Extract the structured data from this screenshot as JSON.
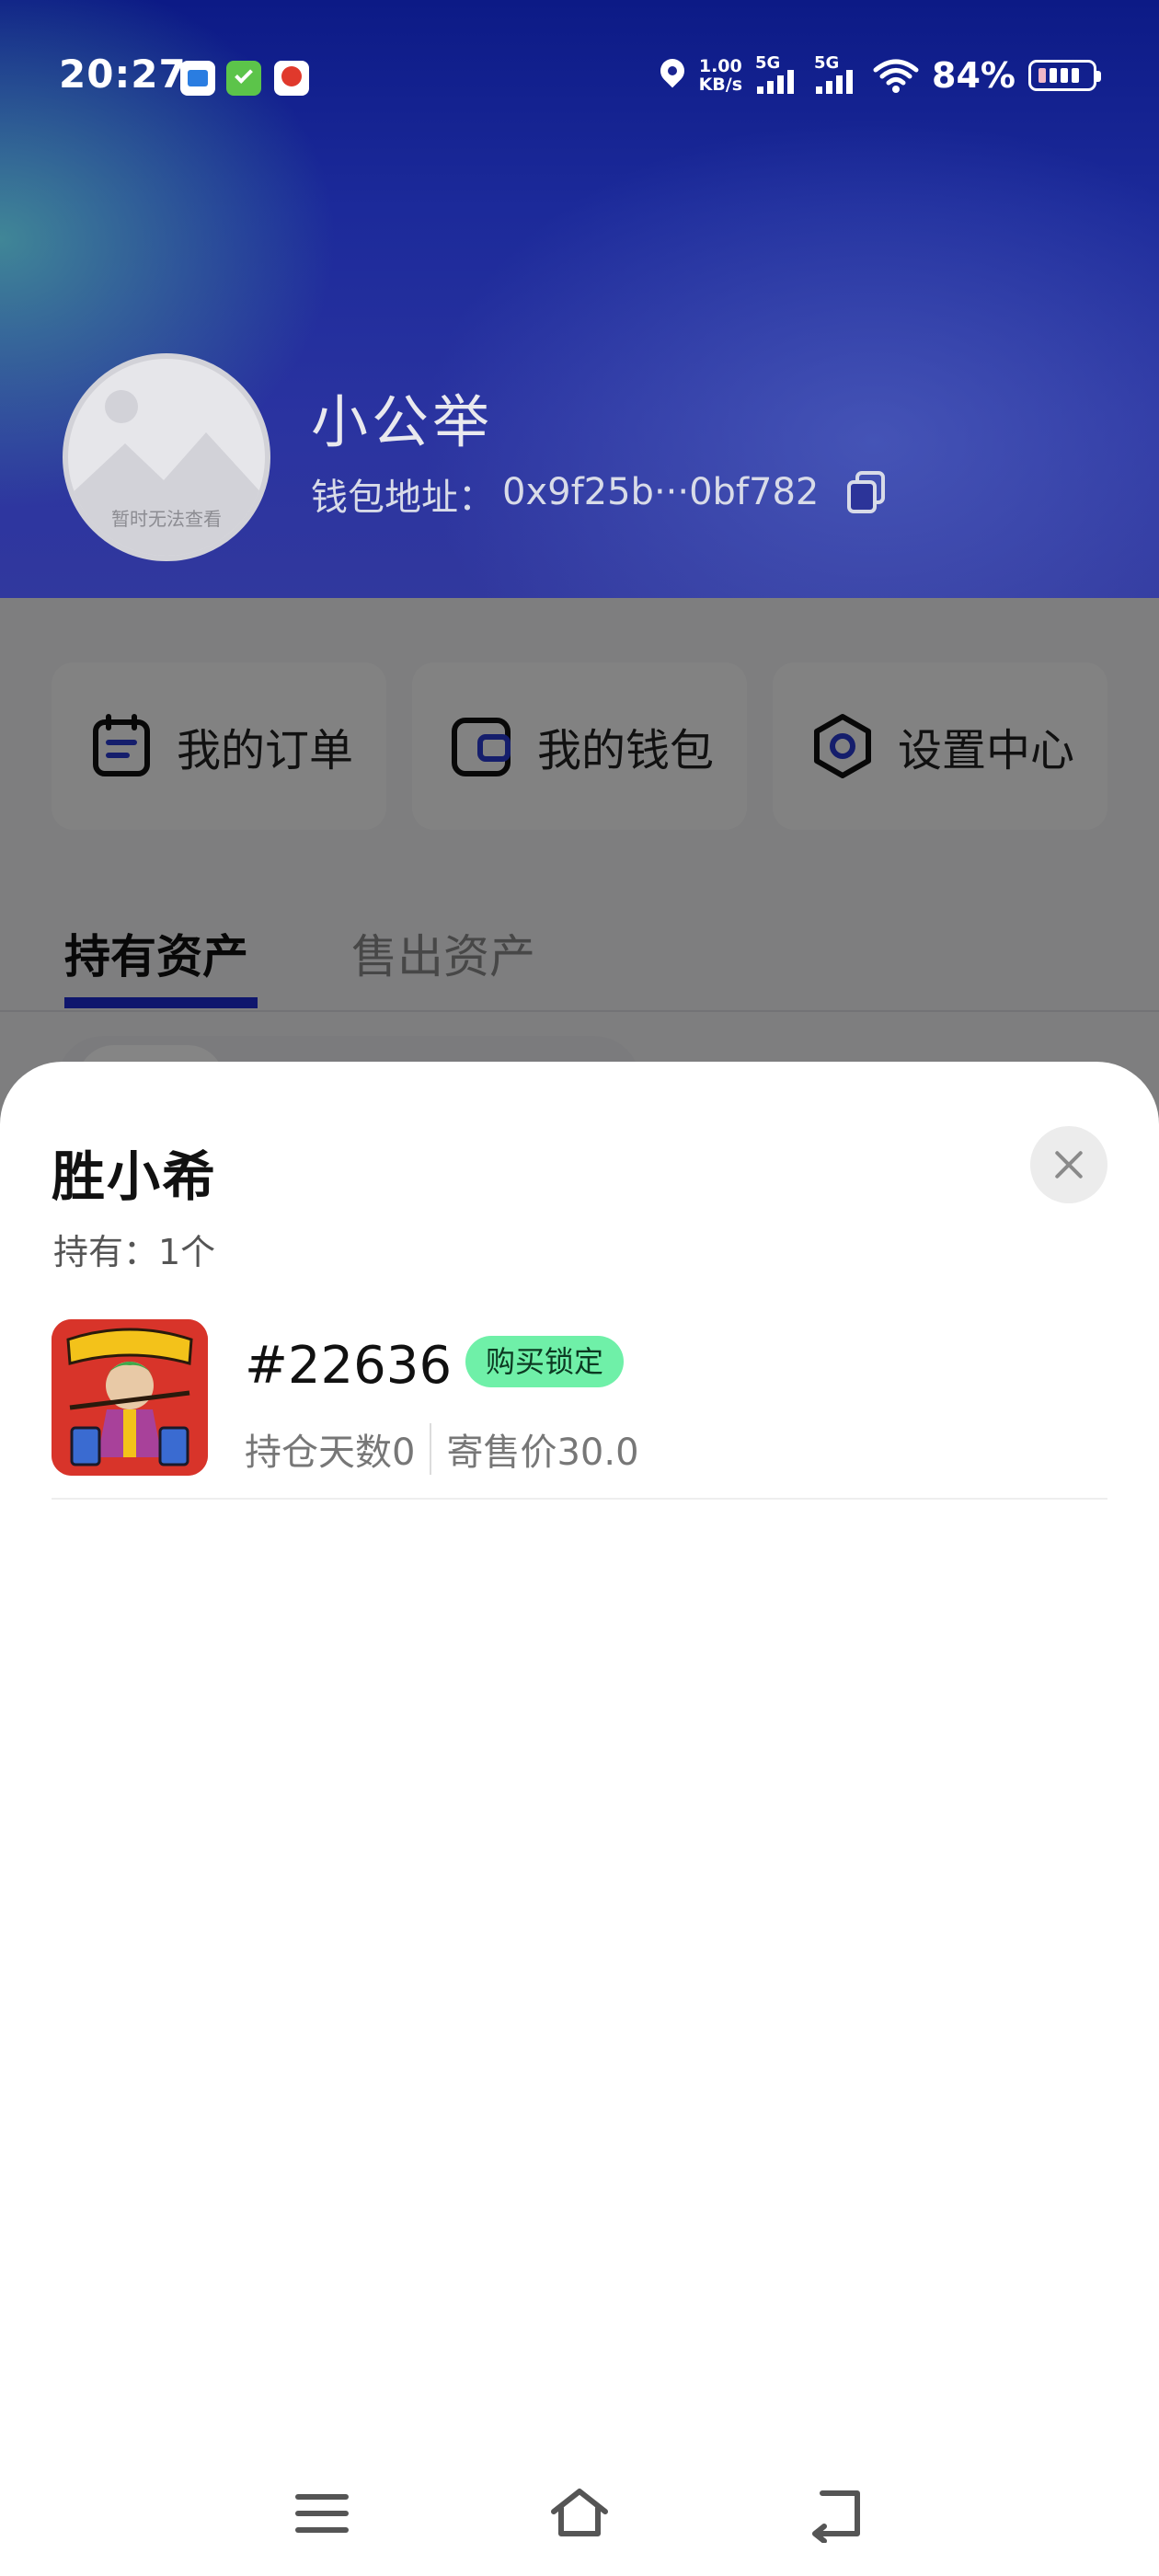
{
  "status_bar": {
    "time": "20:27",
    "net_speed_value": "1.00",
    "net_speed_unit": "KB/s",
    "sim1_label": "5G",
    "sim2_label": "5G",
    "battery": "84%"
  },
  "profile": {
    "avatar_placeholder": "暂时无法查看",
    "name": "小公举",
    "wallet_label": "钱包地址：",
    "wallet_address": "0x9f25b···0bf782"
  },
  "menu": [
    {
      "label": "我的订单",
      "icon": "order-icon"
    },
    {
      "label": "我的钱包",
      "icon": "wallet-icon"
    },
    {
      "label": "设置中心",
      "icon": "settings-icon"
    }
  ],
  "tabs": [
    {
      "label": "持有资产",
      "active": true
    },
    {
      "label": "售出资产",
      "active": false
    }
  ],
  "sheet": {
    "title": "胜小希",
    "held_count": "持有：1个",
    "items": [
      {
        "id": "#22636",
        "badge": "购买锁定",
        "hold_days": "持仓天数0",
        "consign_price": "寄售价30.0"
      }
    ]
  },
  "colors": {
    "accent": "#1d2bd1",
    "badge_bg": "#6ff0a8",
    "header_top": "#0c1a86"
  }
}
